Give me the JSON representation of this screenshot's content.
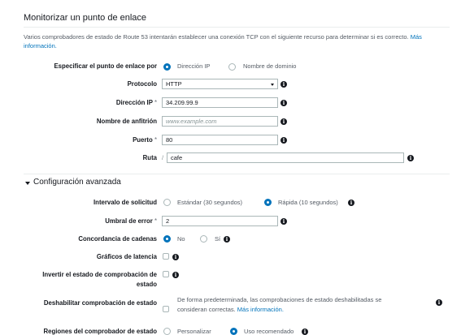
{
  "header": {
    "title": "Monitorizar un punto de enlace"
  },
  "intro": {
    "text": "Varios comprobadores de estado de Route 53 intentarán establecer una conexión TCP con el siguiente recurso para determinar si es correcto.",
    "link": "Más información."
  },
  "endpoint_by": {
    "label": "Especificar el punto de enlace por",
    "options": [
      "Dirección IP",
      "Nombre de dominio"
    ],
    "selected": "Dirección IP"
  },
  "protocol": {
    "label": "Protocolo",
    "value": "HTTP"
  },
  "ip": {
    "label": "Dirección IP",
    "required": "*",
    "value": "34.209.99.9"
  },
  "hostname": {
    "label": "Nombre de anfitrión",
    "placeholder": "www.example.com"
  },
  "port": {
    "label": "Puerto",
    "required": "*",
    "value": "80"
  },
  "path": {
    "label": "Ruta",
    "prefix": "/",
    "value": "cafe"
  },
  "advanced": {
    "title": "Configuración avanzada",
    "expanded": true
  },
  "request_interval": {
    "label": "Intervalo de solicitud",
    "options": [
      "Estándar (30 segundos)",
      "Rápida (10 segundos)"
    ],
    "selected": "Rápida (10 segundos)"
  },
  "failure_threshold": {
    "label": "Umbral de error",
    "required": "*",
    "value": "2"
  },
  "string_matching": {
    "label": "Concordancia de cadenas",
    "options": [
      "No",
      "Sí"
    ],
    "selected": "No"
  },
  "latency_graphs": {
    "label": "Gráficos de latencia",
    "checked": false
  },
  "invert": {
    "label_line1": "Invertir el estado de comprobación de",
    "label_line2": "estado",
    "checked": false
  },
  "disable": {
    "label": "Deshabilitar comprobación de estado",
    "note_line1": "De forma predeterminada, las comprobaciones de estado deshabilitadas se",
    "note_line2": "consideran correctas.",
    "link": "Más información.",
    "checked": false
  },
  "regions": {
    "label": "Regiones del comprobador de estado",
    "options": [
      "Personalizar",
      "Uso recomendado"
    ],
    "selected": "Uso recomendado"
  },
  "icons": {
    "info": "info-icon",
    "dropdown": "caret-down-icon",
    "expand": "caret-down-icon"
  },
  "colors": {
    "accent": "#0073bb",
    "text": "#16191f",
    "muted": "#545b64",
    "border": "#aab7b8"
  }
}
